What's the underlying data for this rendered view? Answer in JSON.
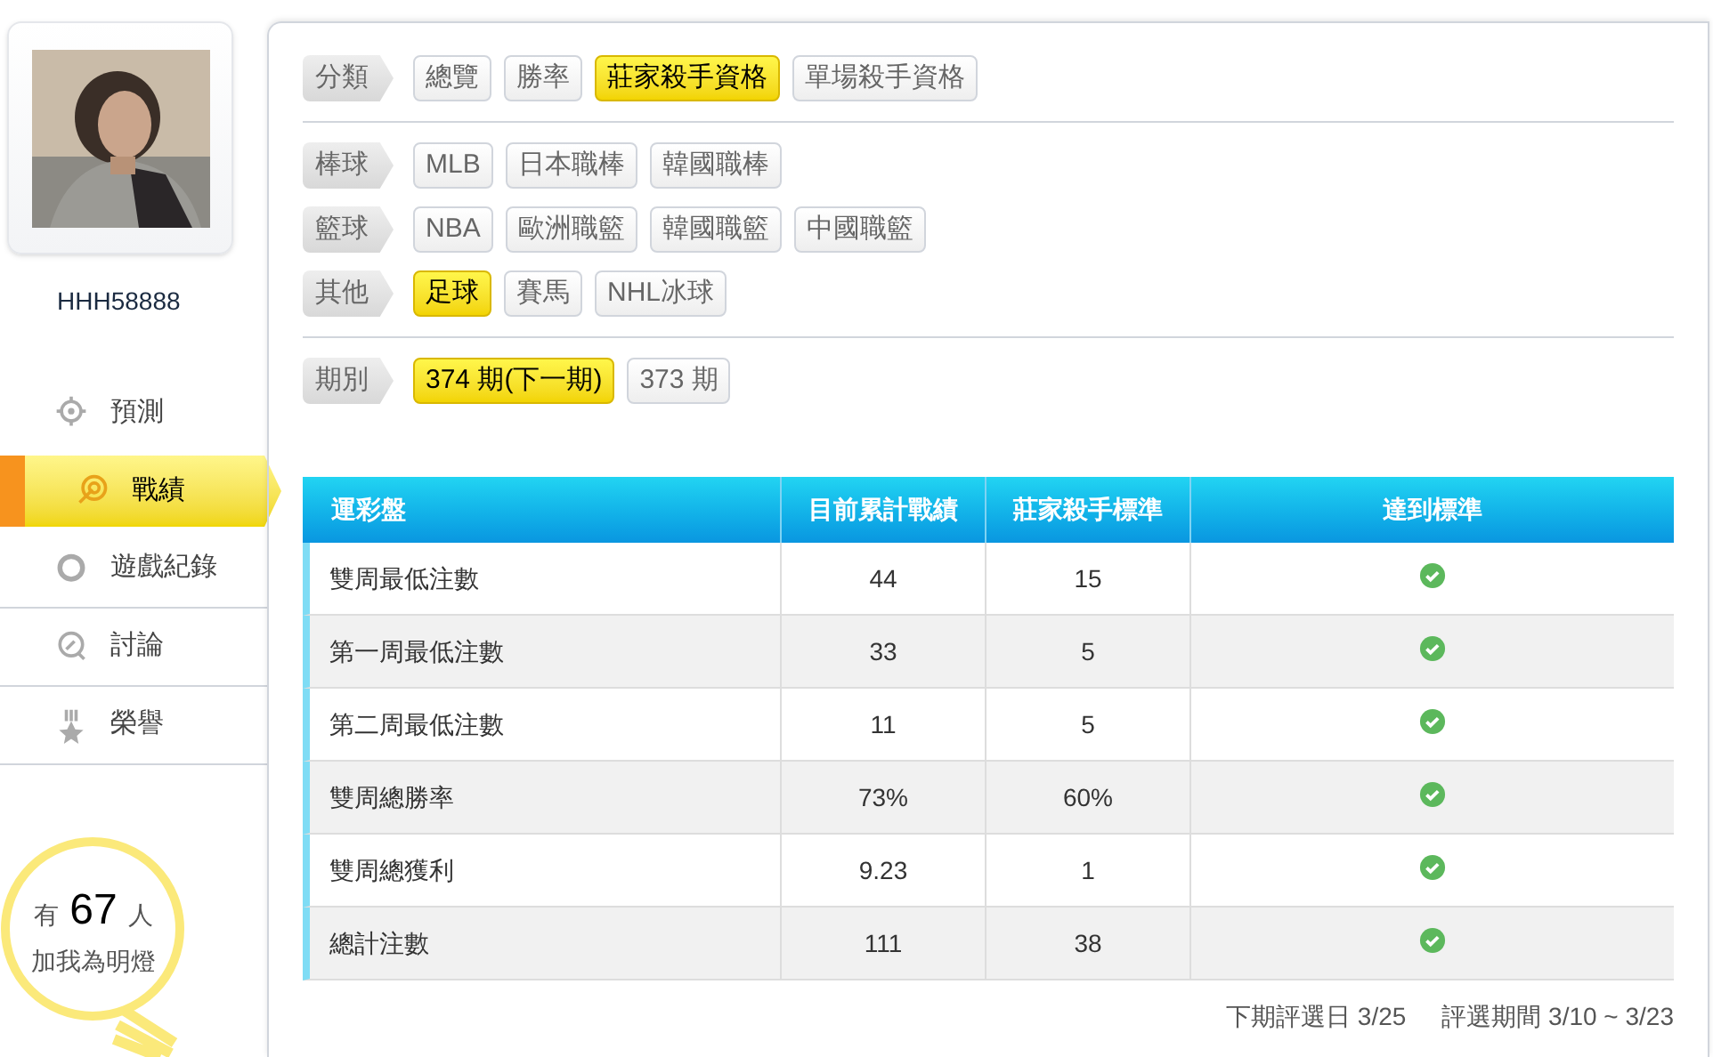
{
  "user": {
    "name": "HHH58888"
  },
  "nav": [
    {
      "label": "預測",
      "selected": false
    },
    {
      "label": "戰績",
      "selected": true
    },
    {
      "label": "遊戲紀錄",
      "selected": false
    },
    {
      "label": "討論",
      "selected": false
    },
    {
      "label": "榮譽",
      "selected": false
    }
  ],
  "fans": {
    "prefix": "有",
    "count": "67",
    "suffix": "人",
    "caption": "加我為明燈"
  },
  "filter_sections": [
    [
      {
        "label": "分類",
        "options": [
          {
            "label": "總覽",
            "selected": false
          },
          {
            "label": "勝率",
            "selected": false
          },
          {
            "label": "莊家殺手資格",
            "selected": true
          },
          {
            "label": "單場殺手資格",
            "selected": false
          }
        ]
      }
    ],
    [
      {
        "label": "棒球",
        "options": [
          {
            "label": "MLB",
            "selected": false
          },
          {
            "label": "日本職棒",
            "selected": false
          },
          {
            "label": "韓國職棒",
            "selected": false
          }
        ]
      },
      {
        "label": "籃球",
        "options": [
          {
            "label": "NBA",
            "selected": false
          },
          {
            "label": "歐洲職籃",
            "selected": false
          },
          {
            "label": "韓國職籃",
            "selected": false
          },
          {
            "label": "中國職籃",
            "selected": false
          }
        ]
      },
      {
        "label": "其他",
        "options": [
          {
            "label": "足球",
            "selected": true
          },
          {
            "label": "賽馬",
            "selected": false
          },
          {
            "label": "NHL冰球",
            "selected": false
          }
        ]
      }
    ],
    [
      {
        "label": "期別",
        "options": [
          {
            "label": "374 期(下一期)",
            "selected": true
          },
          {
            "label": "373 期",
            "selected": false
          }
        ]
      }
    ]
  ],
  "table": {
    "columns": [
      "運彩盤",
      "目前累計戰績",
      "莊家殺手標準",
      "達到標準"
    ],
    "rows": [
      {
        "cells": [
          "雙周最低注數",
          "44",
          "15"
        ],
        "met": true
      },
      {
        "cells": [
          "第一周最低注數",
          "33",
          "5"
        ],
        "met": true
      },
      {
        "cells": [
          "第二周最低注數",
          "11",
          "5"
        ],
        "met": true
      },
      {
        "cells": [
          "雙周總勝率",
          "73%",
          "60%"
        ],
        "met": true
      },
      {
        "cells": [
          "雙周總獲利",
          "9.23",
          "1"
        ],
        "met": true
      },
      {
        "cells": [
          "總計注數",
          "111",
          "38"
        ],
        "met": true
      }
    ]
  },
  "footer": [
    "下期評選日 3/25",
    "評選期間 3/10 ~ 3/23"
  ]
}
